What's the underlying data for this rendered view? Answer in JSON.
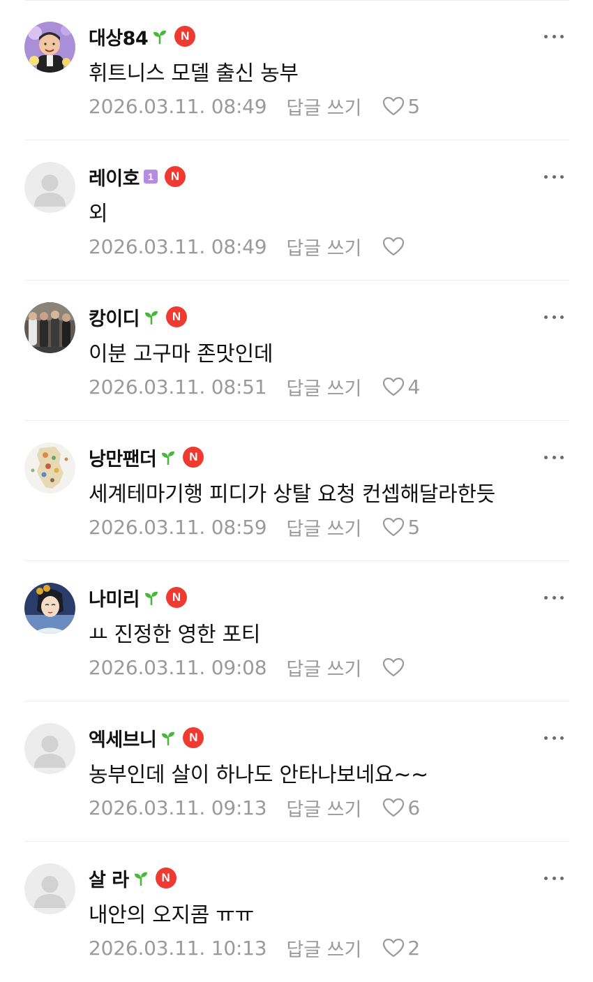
{
  "comments": [
    {
      "nickname": "대상84",
      "level": "sprout",
      "content": "휘트니스 모델 출신 농부",
      "timestamp": "2026.03.11. 08:49",
      "reply_label": "답글 쓰기",
      "likes": "5",
      "avatar": "photo"
    },
    {
      "nickname": "레이호",
      "level": "level-1",
      "content": "외",
      "timestamp": "2026.03.11. 08:49",
      "reply_label": "답글 쓰기",
      "likes": "",
      "avatar": "default"
    },
    {
      "nickname": "캉이디",
      "level": "sprout",
      "content": "이분 고구마 존맛인데",
      "timestamp": "2026.03.11. 08:51",
      "reply_label": "답글 쓰기",
      "likes": "4",
      "avatar": "photo"
    },
    {
      "nickname": "낭만팬더",
      "level": "sprout",
      "content": "세계테마기행 피디가 상탈 요청 컨셉해달라한듯",
      "timestamp": "2026.03.11. 08:59",
      "reply_label": "답글 쓰기",
      "likes": "5",
      "avatar": "photo"
    },
    {
      "nickname": "나미리",
      "level": "sprout",
      "content": "ㅛ 진정한 영한 포티",
      "timestamp": "2026.03.11. 09:08",
      "reply_label": "답글 쓰기",
      "likes": "",
      "avatar": "photo"
    },
    {
      "nickname": "엑세브니",
      "level": "sprout",
      "content": "농부인데 살이 하나도 안타나보네요~~",
      "timestamp": "2026.03.11. 09:13",
      "reply_label": "답글 쓰기",
      "likes": "6",
      "avatar": "default"
    },
    {
      "nickname": "살 라",
      "level": "sprout",
      "content": "내안의 오지콤 ㅠㅠ",
      "timestamp": "2026.03.11. 10:13",
      "reply_label": "답글 쓰기",
      "likes": "2",
      "avatar": "default"
    }
  ],
  "badge_label": "N",
  "level_1_label": "1",
  "colors": {
    "badge": "#ee3a30",
    "sprout": "#48b83b",
    "level_1": "#b58ce3",
    "meta_text": "#9a9a9a"
  }
}
